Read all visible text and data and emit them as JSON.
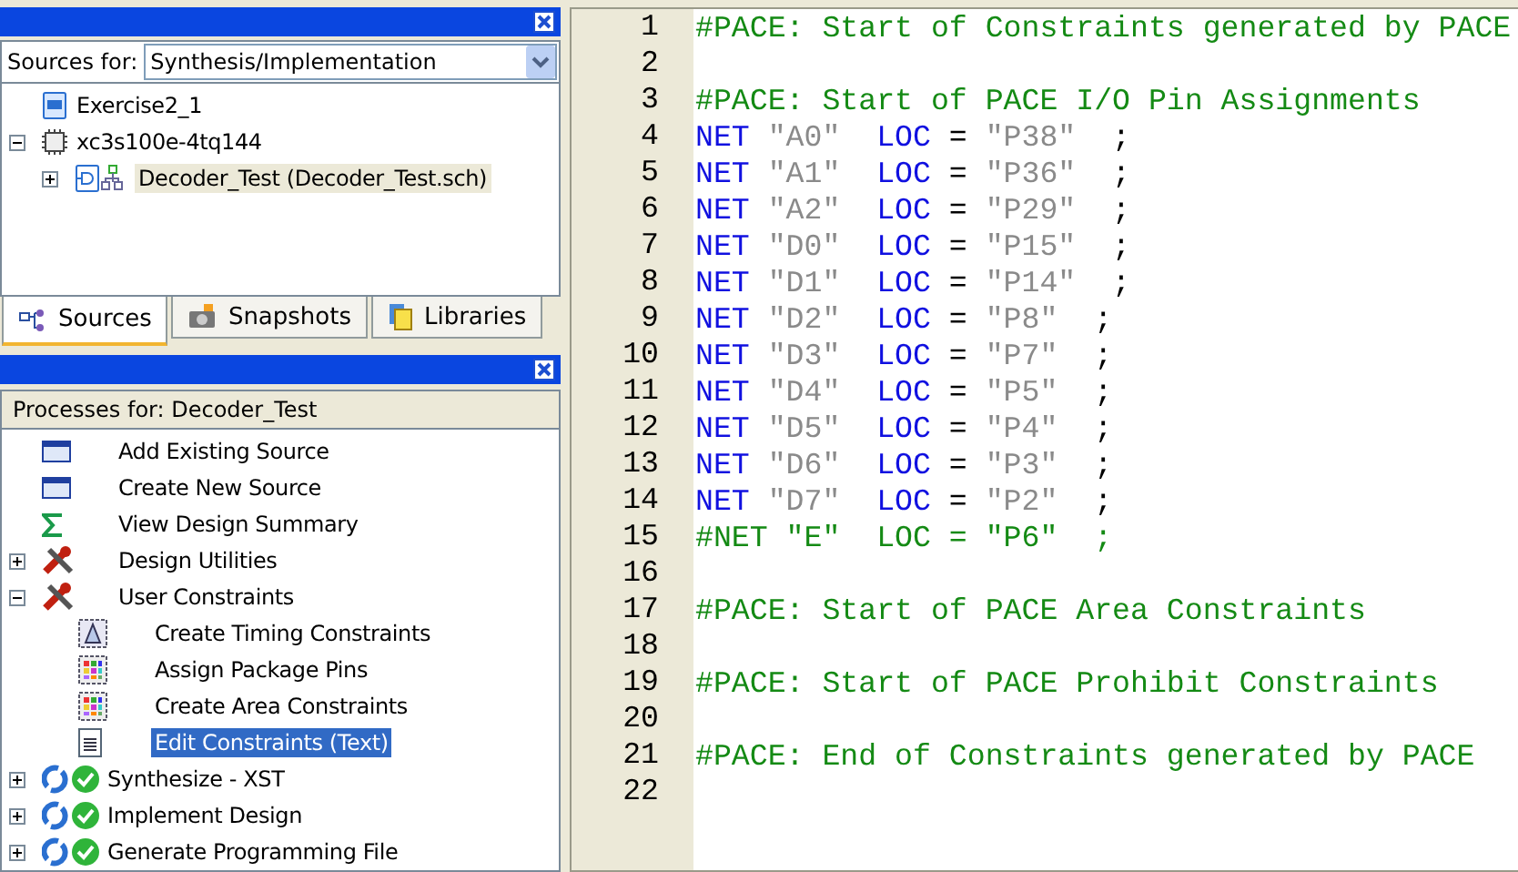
{
  "sources_panel": {
    "label": "Sources for:",
    "dropdown": "Synthesis/Implementation",
    "tree": [
      {
        "label": "Exercise2_1",
        "kind": "project",
        "selected": false
      },
      {
        "label": "xc3s100e-4tq144",
        "kind": "chip",
        "selected": false,
        "expanded": true,
        "children": [
          {
            "label": "Decoder_Test (Decoder_Test.sch)",
            "kind": "schematic",
            "selected": true,
            "expanded": false
          }
        ]
      }
    ],
    "tabs": [
      {
        "label": "Sources",
        "kind": "sources",
        "selected": true
      },
      {
        "label": "Snapshots",
        "kind": "snapshots",
        "selected": false
      },
      {
        "label": "Libraries",
        "kind": "libraries",
        "selected": false
      }
    ]
  },
  "processes_panel": {
    "header": "Processes for: Decoder_Test",
    "tree": [
      {
        "label": "Add Existing Source",
        "kind": "window",
        "selected": false
      },
      {
        "label": "Create New Source",
        "kind": "window",
        "selected": false
      },
      {
        "label": "View Design Summary",
        "kind": "sigma",
        "selected": false
      },
      {
        "label": "Design Utilities",
        "kind": "tools",
        "selected": false,
        "expanded": false
      },
      {
        "label": "User Constraints",
        "kind": "tools",
        "selected": false,
        "expanded": true,
        "children": [
          {
            "label": "Create Timing Constraints",
            "kind": "timing",
            "selected": false
          },
          {
            "label": "Assign Package Pins",
            "kind": "grid",
            "selected": false
          },
          {
            "label": "Create Area Constraints",
            "kind": "grid",
            "selected": false
          },
          {
            "label": "Edit Constraints (Text)",
            "kind": "text",
            "selected": true
          }
        ]
      },
      {
        "label": "Synthesize - XST",
        "kind": "run",
        "selected": false,
        "expanded": false
      },
      {
        "label": "Implement Design",
        "kind": "run",
        "selected": false,
        "expanded": false
      },
      {
        "label": "Generate Programming File",
        "kind": "run",
        "selected": false,
        "expanded": false
      }
    ]
  },
  "editor": {
    "lines": [
      {
        "number": "1",
        "tokens": [
          {
            "kind": "comment",
            "text": "#PACE: Start of Constraints generated by PACE"
          }
        ]
      },
      {
        "number": "2"
      },
      {
        "number": "3",
        "tokens": [
          {
            "kind": "comment",
            "text": "#PACE: Start of PACE I/O Pin Assignments"
          }
        ]
      },
      {
        "number": "4",
        "tokens": [
          {
            "kind": "keyword",
            "text": "NET"
          },
          {
            "kind": "string",
            "text": " \"A0\"  "
          },
          {
            "kind": "keyword",
            "text": "LOC"
          },
          {
            "kind": "plain",
            "text": " = "
          },
          {
            "kind": "string",
            "text": "\"P38\""
          },
          {
            "kind": "plain",
            "text": "  ;"
          }
        ]
      },
      {
        "number": "5",
        "tokens": [
          {
            "kind": "keyword",
            "text": "NET"
          },
          {
            "kind": "string",
            "text": " \"A1\"  "
          },
          {
            "kind": "keyword",
            "text": "LOC"
          },
          {
            "kind": "plain",
            "text": " = "
          },
          {
            "kind": "string",
            "text": "\"P36\""
          },
          {
            "kind": "plain",
            "text": "  ;"
          }
        ]
      },
      {
        "number": "6",
        "tokens": [
          {
            "kind": "keyword",
            "text": "NET"
          },
          {
            "kind": "string",
            "text": " \"A2\"  "
          },
          {
            "kind": "keyword",
            "text": "LOC"
          },
          {
            "kind": "plain",
            "text": " = "
          },
          {
            "kind": "string",
            "text": "\"P29\""
          },
          {
            "kind": "plain",
            "text": "  ;"
          }
        ]
      },
      {
        "number": "7",
        "tokens": [
          {
            "kind": "keyword",
            "text": "NET"
          },
          {
            "kind": "string",
            "text": " \"D0\"  "
          },
          {
            "kind": "keyword",
            "text": "LOC"
          },
          {
            "kind": "plain",
            "text": " = "
          },
          {
            "kind": "string",
            "text": "\"P15\""
          },
          {
            "kind": "plain",
            "text": "  ;"
          }
        ]
      },
      {
        "number": "8",
        "tokens": [
          {
            "kind": "keyword",
            "text": "NET"
          },
          {
            "kind": "string",
            "text": " \"D1\"  "
          },
          {
            "kind": "keyword",
            "text": "LOC"
          },
          {
            "kind": "plain",
            "text": " = "
          },
          {
            "kind": "string",
            "text": "\"P14\""
          },
          {
            "kind": "plain",
            "text": "  ;"
          }
        ]
      },
      {
        "number": "9",
        "tokens": [
          {
            "kind": "keyword",
            "text": "NET"
          },
          {
            "kind": "string",
            "text": " \"D2\"  "
          },
          {
            "kind": "keyword",
            "text": "LOC"
          },
          {
            "kind": "plain",
            "text": " = "
          },
          {
            "kind": "string",
            "text": "\"P8\""
          },
          {
            "kind": "plain",
            "text": "  ;"
          }
        ]
      },
      {
        "number": "10",
        "tokens": [
          {
            "kind": "keyword",
            "text": "NET"
          },
          {
            "kind": "string",
            "text": " \"D3\"  "
          },
          {
            "kind": "keyword",
            "text": "LOC"
          },
          {
            "kind": "plain",
            "text": " = "
          },
          {
            "kind": "string",
            "text": "\"P7\""
          },
          {
            "kind": "plain",
            "text": "  ;"
          }
        ]
      },
      {
        "number": "11",
        "tokens": [
          {
            "kind": "keyword",
            "text": "NET"
          },
          {
            "kind": "string",
            "text": " \"D4\"  "
          },
          {
            "kind": "keyword",
            "text": "LOC"
          },
          {
            "kind": "plain",
            "text": " = "
          },
          {
            "kind": "string",
            "text": "\"P5\""
          },
          {
            "kind": "plain",
            "text": "  ;"
          }
        ]
      },
      {
        "number": "12",
        "tokens": [
          {
            "kind": "keyword",
            "text": "NET"
          },
          {
            "kind": "string",
            "text": " \"D5\"  "
          },
          {
            "kind": "keyword",
            "text": "LOC"
          },
          {
            "kind": "plain",
            "text": " = "
          },
          {
            "kind": "string",
            "text": "\"P4\""
          },
          {
            "kind": "plain",
            "text": "  ;"
          }
        ]
      },
      {
        "number": "13",
        "tokens": [
          {
            "kind": "keyword",
            "text": "NET"
          },
          {
            "kind": "string",
            "text": " \"D6\"  "
          },
          {
            "kind": "keyword",
            "text": "LOC"
          },
          {
            "kind": "plain",
            "text": " = "
          },
          {
            "kind": "string",
            "text": "\"P3\""
          },
          {
            "kind": "plain",
            "text": "  ;"
          }
        ]
      },
      {
        "number": "14",
        "tokens": [
          {
            "kind": "keyword",
            "text": "NET"
          },
          {
            "kind": "string",
            "text": " \"D7\"  "
          },
          {
            "kind": "keyword",
            "text": "LOC"
          },
          {
            "kind": "plain",
            "text": " = "
          },
          {
            "kind": "string",
            "text": "\"P2\""
          },
          {
            "kind": "plain",
            "text": "  ;"
          }
        ]
      },
      {
        "number": "15",
        "tokens": [
          {
            "kind": "comment",
            "text": "#NET \"E\"  LOC = \"P6\"  ;"
          }
        ]
      },
      {
        "number": "16"
      },
      {
        "number": "17",
        "tokens": [
          {
            "kind": "comment",
            "text": "#PACE: Start of PACE Area Constraints"
          }
        ]
      },
      {
        "number": "18"
      },
      {
        "number": "19",
        "tokens": [
          {
            "kind": "comment",
            "text": "#PACE: Start of PACE Prohibit Constraints"
          }
        ]
      },
      {
        "number": "20"
      },
      {
        "number": "21",
        "tokens": [
          {
            "kind": "comment",
            "text": "#PACE: End of Constraints generated by PACE"
          }
        ]
      },
      {
        "number": "22"
      }
    ]
  }
}
